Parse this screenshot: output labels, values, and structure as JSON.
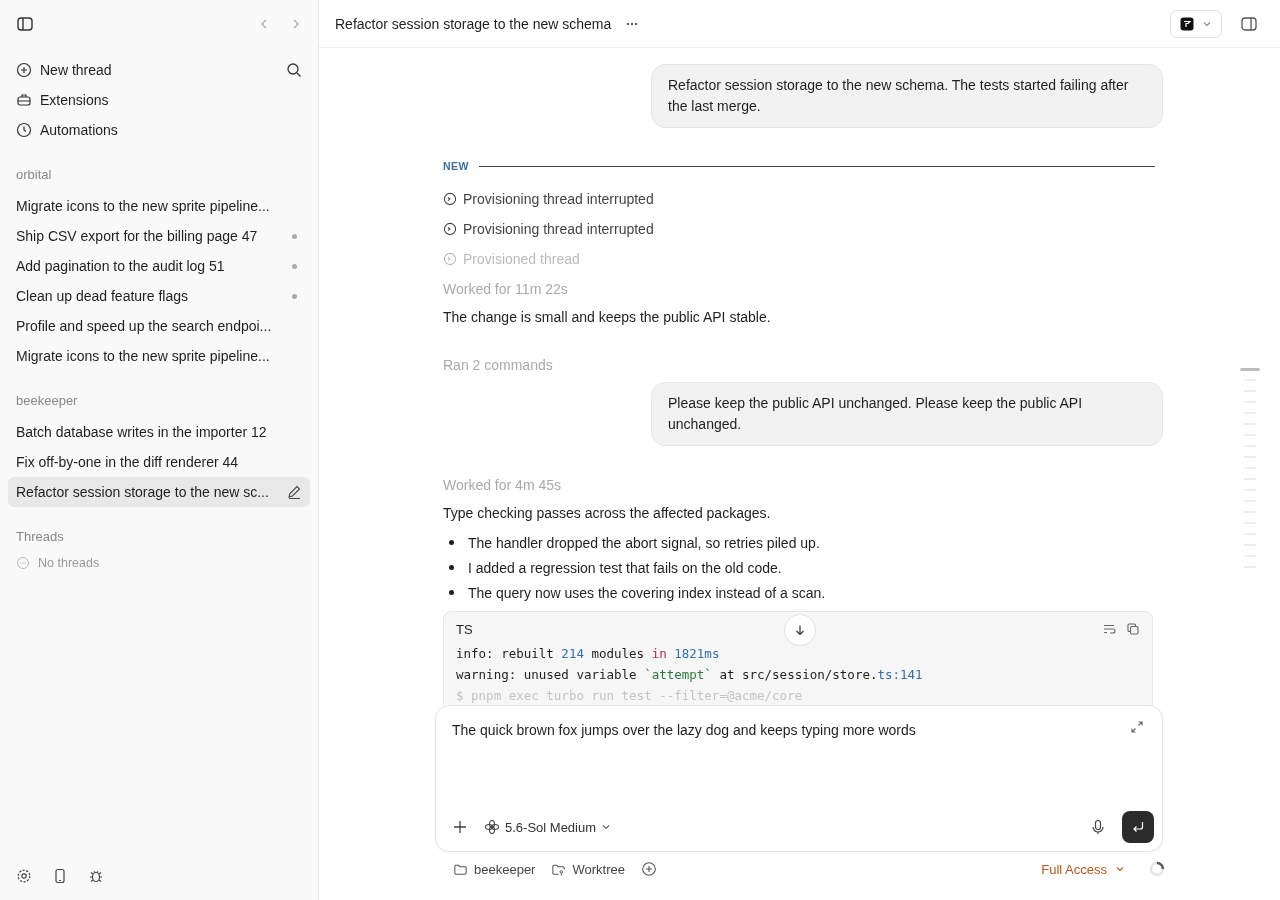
{
  "sidebar": {
    "nav": [
      {
        "kind": "new",
        "label": "New thread"
      },
      {
        "kind": "extensions",
        "label": "Extensions"
      },
      {
        "kind": "automations",
        "label": "Automations"
      }
    ],
    "groups": [
      {
        "name": "orbital",
        "threads": [
          {
            "title": "Migrate icons to the new sprite pipeline...",
            "unread": false,
            "selected": false
          },
          {
            "title": "Ship CSV export for the billing page 47",
            "unread": true,
            "selected": false
          },
          {
            "title": "Add pagination to the audit log 51",
            "unread": true,
            "selected": false
          },
          {
            "title": "Clean up dead feature flags",
            "unread": true,
            "selected": false
          },
          {
            "title": "Profile and speed up the search endpoi...",
            "unread": false,
            "selected": false
          },
          {
            "title": "Migrate icons to the new sprite pipeline...",
            "unread": false,
            "selected": false
          }
        ]
      },
      {
        "name": "beekeeper",
        "threads": [
          {
            "title": "Batch database writes in the importer 12",
            "unread": false,
            "selected": false
          },
          {
            "title": "Fix off-by-one in the diff renderer 44",
            "unread": false,
            "selected": false
          },
          {
            "title": "Refactor session storage to the new sc...",
            "selected": true
          }
        ]
      }
    ],
    "threads": {
      "label": "Threads",
      "empty": "No threads"
    }
  },
  "header": {
    "title": "Refactor session storage to the new schema"
  },
  "messages": [
    {
      "kind": "user",
      "text": "Refactor session storage to the new schema. The tests started failing after the last merge."
    },
    {
      "kind": "divider",
      "text": "NEW"
    },
    {
      "kind": "status",
      "text": "Provisioning thread interrupted",
      "dim": false
    },
    {
      "kind": "status",
      "text": "Provisioning thread interrupted",
      "dim": false
    },
    {
      "kind": "status",
      "text": "Provisioned thread",
      "dim": true
    },
    {
      "kind": "meta",
      "text": "Worked for 11m 22s"
    },
    {
      "kind": "text",
      "text": "The change is small and keeps the public API stable."
    },
    {
      "kind": "meta",
      "text": "Ran 2 commands"
    },
    {
      "kind": "user",
      "text": "Please keep the public API unchanged. Please keep the public API unchanged."
    },
    {
      "kind": "meta",
      "text": "Worked for 4m 45s"
    },
    {
      "kind": "text",
      "text": "Type checking passes across the affected packages."
    },
    {
      "kind": "bullets",
      "items": [
        "The handler dropped the abort signal, so retries piled up.",
        "I added a regression test that fails on the old code.",
        "The query now uses the covering index instead of a scan."
      ]
    },
    {
      "kind": "code",
      "lang": "TS",
      "lines": [
        [
          {
            "kind": "plain",
            "s": "info: rebuilt "
          },
          {
            "kind": "num",
            "s": "214"
          },
          {
            "kind": "plain",
            "s": " modules "
          },
          {
            "kind": "kw",
            "s": "in"
          },
          {
            "kind": "num",
            "s": " 1821ms"
          }
        ],
        [
          {
            "kind": "plain",
            "s": "warning: unused variable "
          },
          {
            "kind": "str",
            "s": "`attempt`"
          },
          {
            "kind": "plain",
            "s": " at src/session/store."
          },
          {
            "kind": "num",
            "s": "ts:141"
          }
        ],
        [
          {
            "kind": "faded",
            "s": "$ pnpm exec turbo run test --filter=@acme/core"
          }
        ]
      ]
    }
  ],
  "composer": {
    "value": "The quick brown fox jumps over the lazy dog and keeps typing more words",
    "model": "5.6-Sol Medium"
  },
  "footer": {
    "folder": "beekeeper",
    "worktree": "Worktree",
    "access": "Full Access"
  }
}
